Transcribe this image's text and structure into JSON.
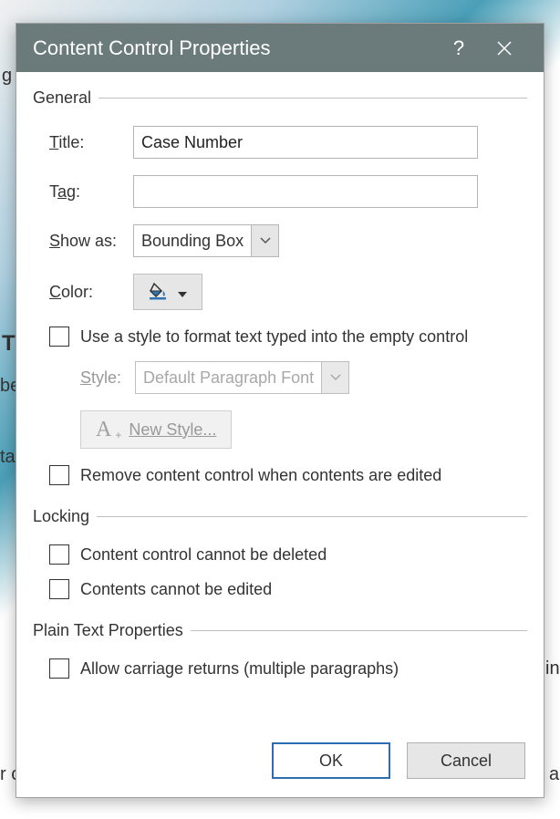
{
  "dialog": {
    "title": "Content Control Properties",
    "help_symbol": "?",
    "close_symbol": "✕"
  },
  "groups": {
    "general": {
      "title": "General",
      "title_label": "Title:",
      "title_value": "Case Number",
      "tag_label": "Tag:",
      "tag_value": "",
      "showas_label": "Show as:",
      "showas_value": "Bounding Box",
      "color_label": "Color:",
      "use_style_label": "Use a style to format text typed into the empty control",
      "style_label": "Style:",
      "style_value": "Default Paragraph Font",
      "newstyle_label": "New Style...",
      "remove_label": "Remove content control when contents are edited"
    },
    "locking": {
      "title": "Locking",
      "cannot_delete_label": "Content control cannot be deleted",
      "cannot_edit_label": "Contents cannot be edited"
    },
    "plaintext": {
      "title": "Plain Text Properties",
      "carriage_label": "Allow carriage returns (multiple paragraphs)"
    }
  },
  "buttons": {
    "ok": "OK",
    "cancel": "Cancel"
  },
  "checkboxes": {
    "use_style": false,
    "remove_on_edit": false,
    "cannot_delete": false,
    "cannot_edit": false,
    "allow_carriage": false
  },
  "background_fragments": {
    "g": "g",
    "T": "T",
    "be": "be",
    "ta": "ta",
    "in": "in",
    "a": "a",
    "rc": "r c"
  }
}
